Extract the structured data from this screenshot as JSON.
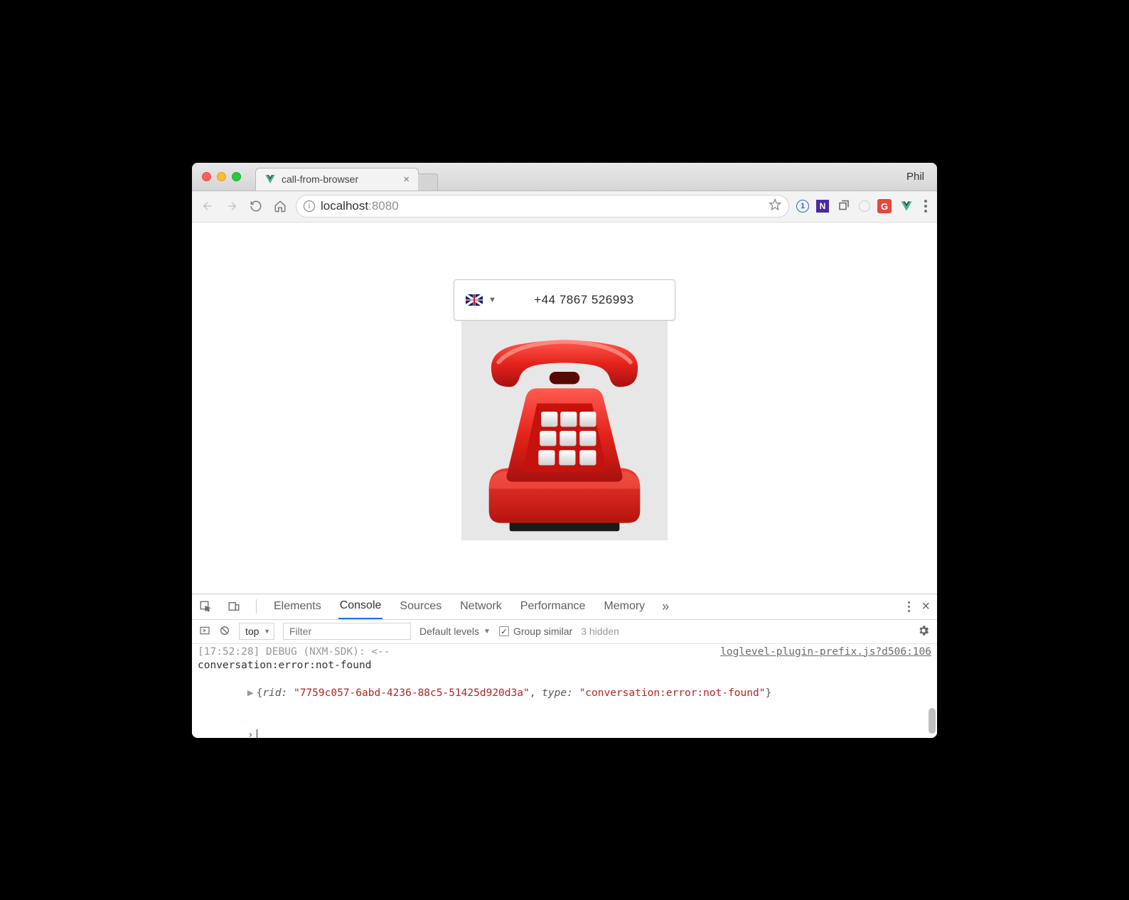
{
  "window": {
    "profile": "Phil"
  },
  "tab": {
    "title": "call-from-browser",
    "favicon": "vue-icon"
  },
  "toolbar": {
    "url_host": "localhost",
    "url_port": ":8080"
  },
  "app": {
    "phone_number": "+44 7867 526993",
    "country": "uk"
  },
  "devtools": {
    "tabs": [
      "Elements",
      "Console",
      "Sources",
      "Network",
      "Performance",
      "Memory"
    ],
    "active_tab": "Console",
    "context": "top",
    "filter_placeholder": "Filter",
    "levels_label": "Default levels",
    "group_label": "Group similar",
    "hidden_label": "3 hidden",
    "log": {
      "partial_top": "[17:52:28] DEBUG (NXM-SDK): <--",
      "src_ref": "loglevel-plugin-prefix.js?d506:106",
      "line2": "conversation:error:not-found",
      "obj_rid_key": "rid:",
      "obj_rid_val": "\"7759c057-6abd-4236-88c5-51425d920d3a\"",
      "obj_type_key": "type:",
      "obj_type_val": "\"conversation:error:not-found\""
    }
  }
}
